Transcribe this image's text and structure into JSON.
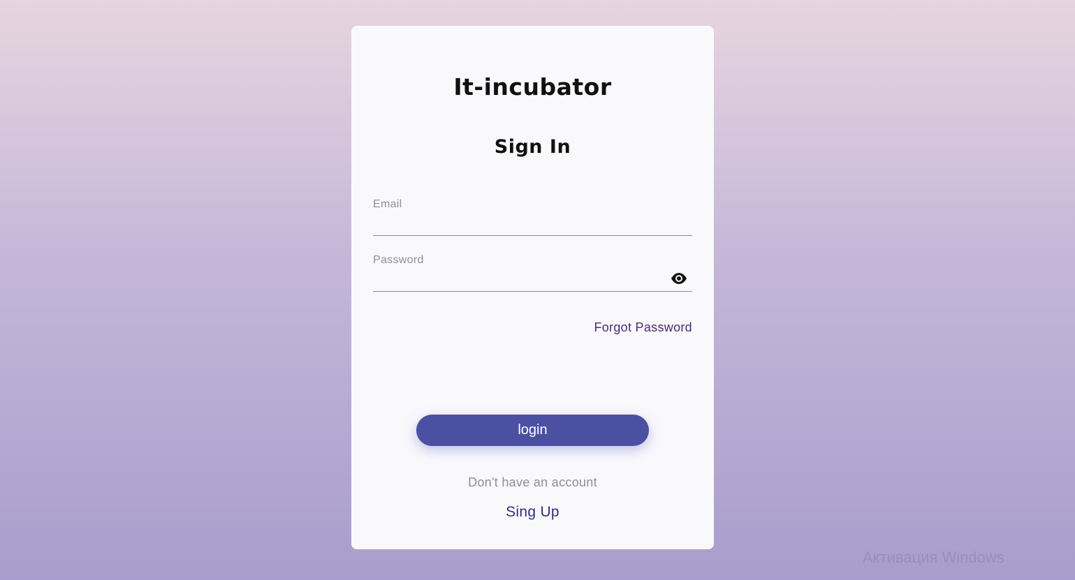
{
  "brand": {
    "title": "It-incubator"
  },
  "form": {
    "heading": "Sign In",
    "email": {
      "label": "Email",
      "value": ""
    },
    "password": {
      "label": "Password",
      "value": "",
      "toggle_icon": "eye-icon"
    },
    "forgot_label": "Forgot Password",
    "login_label": "login",
    "no_account_text": "Don't have an account",
    "signup_label": "Sing Up"
  },
  "overlay": {
    "watermark": "Активация Windows"
  },
  "colors": {
    "accent": "#4b50a3",
    "link": "#4a2a7a",
    "signup_link": "#2e2f7a",
    "card_bg": "#f9f9fc"
  }
}
